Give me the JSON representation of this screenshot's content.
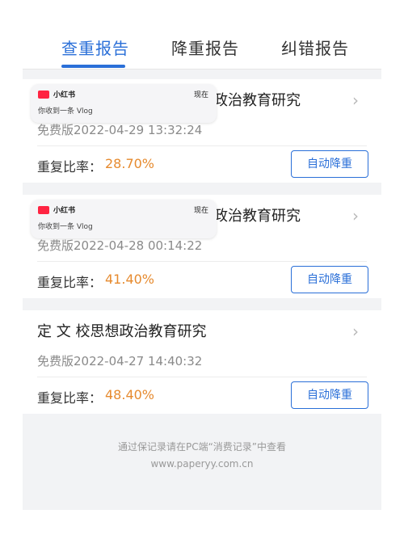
{
  "tabs": [
    {
      "label": "查重报告",
      "active": true
    },
    {
      "label": "降重报告",
      "active": false
    },
    {
      "label": "纠错报告",
      "active": false
    }
  ],
  "cards": [
    {
      "title": "想政治教育研究",
      "date": "免费版2022-04-29 13:32:24",
      "rate_label": "重复比率：",
      "rate_value": "28.70%",
      "button": "自动降重",
      "notification": {
        "app": "小红书",
        "time": "现在",
        "message": "你收到一条 Vlog"
      }
    },
    {
      "title": "想政治教育研究",
      "date": "免费版2022-04-28 00:14:22",
      "rate_label": "重复比率：",
      "rate_value": "41.40%",
      "button": "自动降重",
      "notification": {
        "app": "小红书",
        "time": "现在",
        "message": "你收到一条 Vlog"
      }
    },
    {
      "title": "定    文    校思想政治教育研究",
      "date": "免费版2022-04-27 14:40:32",
      "rate_label": "重复比率：",
      "rate_value": "48.40%",
      "button": "自动降重"
    }
  ],
  "footer": {
    "line1": "通过保记录请在PC端“消费记录”中查看",
    "line2": "www.paperyy.com.cn"
  },
  "colors": {
    "accent": "#2a6fd8",
    "rate": "#e68a2e",
    "background": "#f2f3f5",
    "notification_brand": "#ff2442"
  },
  "icons": {
    "chevron": "chevron-right-icon",
    "notification_logo": "xiaohongshu-logo-icon"
  }
}
